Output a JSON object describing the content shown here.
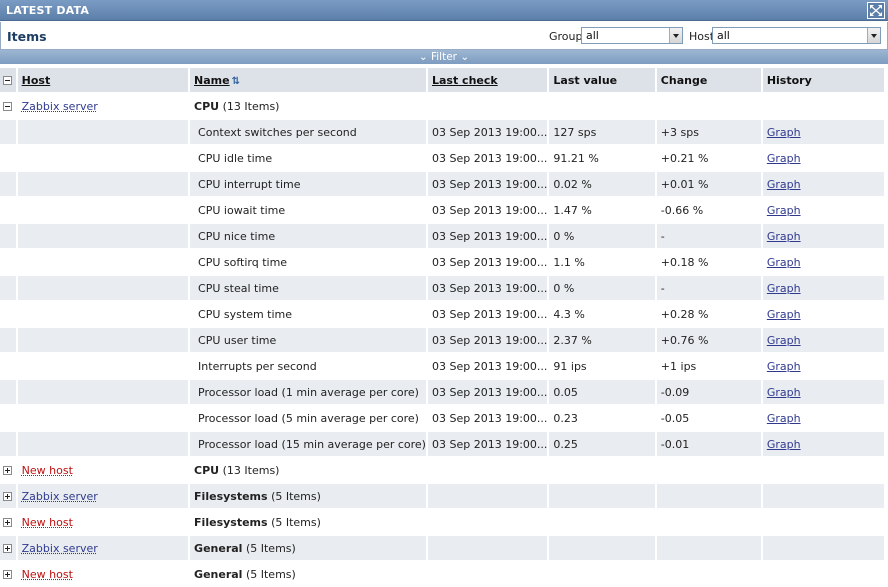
{
  "window": {
    "title": "LATEST DATA",
    "fullscreen_icon": "fullscreen-icon"
  },
  "itemsbar": {
    "heading": "Items",
    "group_label": "Group",
    "group_value": "all",
    "host_label": "Host",
    "host_value": "all"
  },
  "filter": {
    "label": "Filter",
    "icon": "chevron-down-icon"
  },
  "table": {
    "headers": {
      "host": "Host",
      "name": "Name",
      "last_check": "Last check",
      "last_value": "Last value",
      "change": "Change",
      "history": "History"
    },
    "expanded_group": {
      "host": "Zabbix server",
      "app": "CPU",
      "count": "(13 Items)"
    },
    "items": [
      {
        "name": "Context switches per second",
        "last_check": "03 Sep 2013 19:00...",
        "last_value": "127 sps",
        "change": "+3 sps",
        "history": "Graph"
      },
      {
        "name": "CPU idle time",
        "last_check": "03 Sep 2013 19:00...",
        "last_value": "91.21 %",
        "change": "+0.21 %",
        "history": "Graph"
      },
      {
        "name": "CPU interrupt time",
        "last_check": "03 Sep 2013 19:00...",
        "last_value": "0.02 %",
        "change": "+0.01 %",
        "history": "Graph"
      },
      {
        "name": "CPU iowait time",
        "last_check": "03 Sep 2013 19:00...",
        "last_value": "1.47 %",
        "change": "-0.66 %",
        "history": "Graph"
      },
      {
        "name": "CPU nice time",
        "last_check": "03 Sep 2013 19:00...",
        "last_value": "0 %",
        "change": "-",
        "history": "Graph"
      },
      {
        "name": "CPU softirq time",
        "last_check": "03 Sep 2013 19:00...",
        "last_value": "1.1 %",
        "change": "+0.18 %",
        "history": "Graph"
      },
      {
        "name": "CPU steal time",
        "last_check": "03 Sep 2013 19:00...",
        "last_value": "0 %",
        "change": "-",
        "history": "Graph"
      },
      {
        "name": "CPU system time",
        "last_check": "03 Sep 2013 19:00...",
        "last_value": "4.3 %",
        "change": "+0.28 %",
        "history": "Graph"
      },
      {
        "name": "CPU user time",
        "last_check": "03 Sep 2013 19:00...",
        "last_value": "2.37 %",
        "change": "+0.76 %",
        "history": "Graph"
      },
      {
        "name": "Interrupts per second",
        "last_check": "03 Sep 2013 19:00...",
        "last_value": "91 ips",
        "change": "+1 ips",
        "history": "Graph"
      },
      {
        "name": "Processor load (1 min average per core)",
        "last_check": "03 Sep 2013 19:00...",
        "last_value": "0.05",
        "change": "-0.09",
        "history": "Graph"
      },
      {
        "name": "Processor load (5 min average per core)",
        "last_check": "03 Sep 2013 19:00...",
        "last_value": "0.23",
        "change": "-0.05",
        "history": "Graph"
      },
      {
        "name": "Processor load (15 min average per core)",
        "last_check": "03 Sep 2013 19:00...",
        "last_value": "0.25",
        "change": "-0.01",
        "history": "Graph"
      }
    ],
    "collapsed_groups": [
      {
        "host": "New host",
        "host_color": "red",
        "app": "CPU",
        "count": "(13 Items)"
      },
      {
        "host": "Zabbix server",
        "host_color": "blue",
        "app": "Filesystems",
        "count": "(5 Items)"
      },
      {
        "host": "New host",
        "host_color": "red",
        "app": "Filesystems",
        "count": "(5 Items)"
      },
      {
        "host": "Zabbix server",
        "host_color": "blue",
        "app": "General",
        "count": "(5 Items)"
      },
      {
        "host": "New host",
        "host_color": "red",
        "app": "General",
        "count": "(5 Items)"
      }
    ]
  },
  "colors": {
    "title_bar": "#5c7fa9",
    "link_blue": "#2f3a8f",
    "link_red": "#c01010",
    "row_alt": "#e9ecf0",
    "header_bg": "#dde2e9"
  }
}
